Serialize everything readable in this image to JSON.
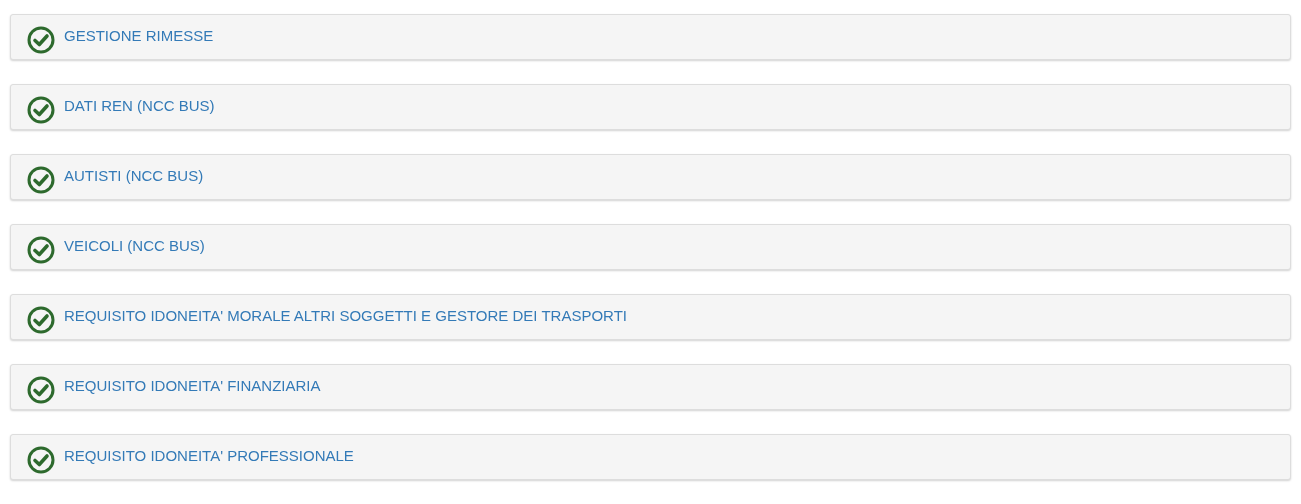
{
  "panels": [
    {
      "title": "GESTIONE RIMESSE",
      "done": true
    },
    {
      "title": "DATI REN (NCC BUS)",
      "done": true
    },
    {
      "title": "AUTISTI (NCC BUS)",
      "done": true
    },
    {
      "title": "VEICOLI (NCC BUS)",
      "done": true
    },
    {
      "title": "REQUISITO IDONEITA' MORALE ALTRI SOGGETTI E GESTORE DEI TRASPORTI",
      "done": true
    },
    {
      "title": "REQUISITO IDONEITA' FINANZIARIA",
      "done": true
    },
    {
      "title": "REQUISITO IDONEITA' PROFESSIONALE",
      "done": true
    }
  ]
}
